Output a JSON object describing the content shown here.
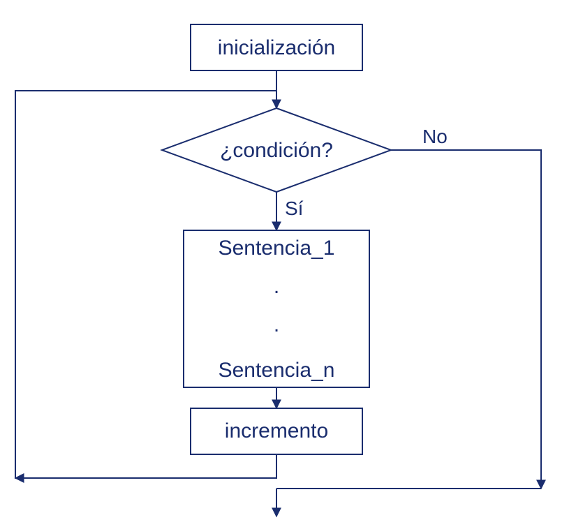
{
  "flowchart": {
    "initialization": "inicialización",
    "condition": "¿condición?",
    "branch_yes": "Sí",
    "branch_no": "No",
    "statement_first": "Sentencia_1",
    "statement_dot1": ".",
    "statement_dot2": ".",
    "statement_last": "Sentencia_n",
    "increment": "incremento"
  },
  "colors": {
    "stroke": "#1a2d6e",
    "text": "#1a2d6e",
    "background": "#ffffff"
  }
}
